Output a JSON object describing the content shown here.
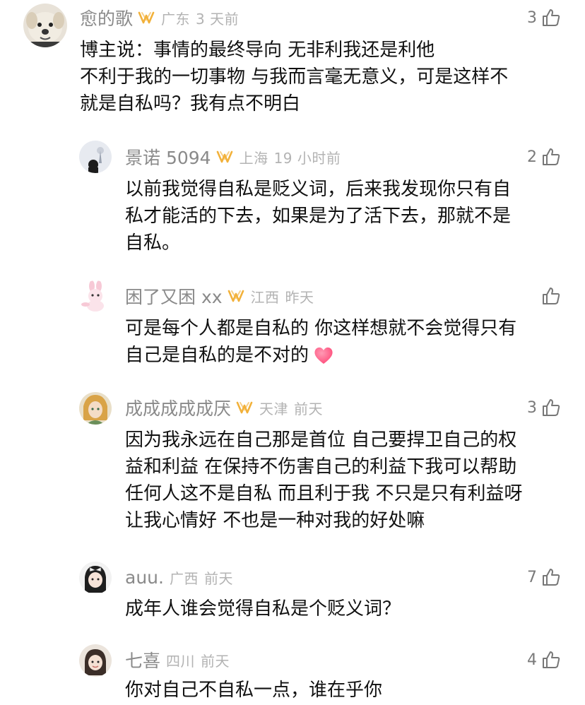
{
  "comments": [
    {
      "username": "愈的歌",
      "location": "广东",
      "time": "3 天前",
      "likes": "3",
      "text": "博主说：事情的最终导向 无非利我还是利他\n不利于我的一切事物 与我而言毫无意义，可是这样不\n就是自私吗？我有点不明白",
      "avatar_icon": "puppy-avatar",
      "badge_icon": "gold-badge-icon"
    },
    {
      "username": "景诺 5094",
      "location": "上海",
      "time": "19 小时前",
      "likes": "2",
      "text": "以前我觉得自私是贬义词，后来我发现你只有自\n私才能活的下去，如果是为了活下去，那就不是\n自私。",
      "avatar_icon": "night-scene-avatar",
      "badge_icon": "gold-badge-icon"
    },
    {
      "username": "困了又困 xx",
      "location": "江西",
      "time": "昨天",
      "likes": "",
      "text": "可是每个人都是自私的 你这样想就不会觉得只有\n自己是自私的是不对的",
      "avatar_icon": "bunny-avatar",
      "badge_icon": "gold-badge-icon",
      "emoji": "heart-emoji"
    },
    {
      "username": "成成成成成厌",
      "location": "天津",
      "time": "前天",
      "likes": "3",
      "text": "因为我永远在自己那是首位 自己要捍卫自己的权\n益和利益 在保持不伤害自己的利益下我可以帮助\n任何人这不是自私 而且利于我 不只是只有利益呀\n让我心情好 不也是一种对我的好处嘛",
      "avatar_icon": "anime-character-avatar",
      "badge_icon": "gold-badge-icon"
    },
    {
      "username": "auu.",
      "location": "广西",
      "time": "前天",
      "likes": "7",
      "text": "成年人谁会觉得自私是个贬义词？",
      "avatar_icon": "girl-with-bow-avatar"
    },
    {
      "username": "七喜",
      "location": "四川",
      "time": "前天",
      "likes": "4",
      "text": "你对自己不自私一点，谁在乎你",
      "avatar_icon": "girl-portrait-avatar"
    }
  ],
  "colors": {
    "username": "#8a8a8a",
    "meta": "#b3b3b3",
    "text": "#111111",
    "badge": "#f2b13a",
    "heart": "#ff4b7a"
  }
}
